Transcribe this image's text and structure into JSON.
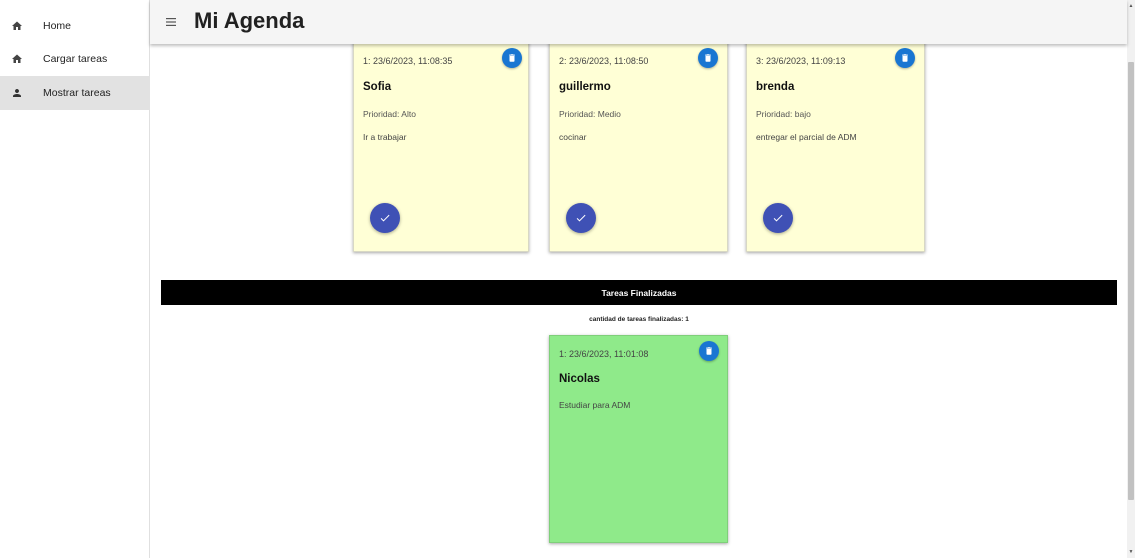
{
  "app": {
    "title": "Mi Agenda"
  },
  "sidebar": {
    "items": [
      {
        "label": "Home",
        "icon": "home-icon"
      },
      {
        "label": "Cargar tareas",
        "icon": "home-icon"
      },
      {
        "label": "Mostrar tareas",
        "icon": "person-icon",
        "active": true
      }
    ]
  },
  "pending": [
    {
      "date": "1: 23/6/2023, 11:08:35",
      "name": "Sofia",
      "priority": "Prioridad: Alto",
      "description": "Ir a trabajar"
    },
    {
      "date": "2: 23/6/2023, 11:08:50",
      "name": "guillermo",
      "priority": "Prioridad: Medio",
      "description": "cocinar"
    },
    {
      "date": "3: 23/6/2023, 11:09:13",
      "name": "brenda",
      "priority": "Prioridad: bajo",
      "description": "entregar el parcial de ADM"
    }
  ],
  "finished": {
    "header": "Tareas Finalizadas",
    "count_text": "cantidad de tareas finalizadas: 1",
    "items": [
      {
        "date": "1: 23/6/2023, 11:01:08",
        "name": "Nicolas",
        "description": "Estudiar para ADM"
      }
    ]
  },
  "colors": {
    "pending_card": "#ffffd6",
    "finished_card": "#8fea8a",
    "delete_button": "#1976d2",
    "check_button": "#3f51b5"
  }
}
